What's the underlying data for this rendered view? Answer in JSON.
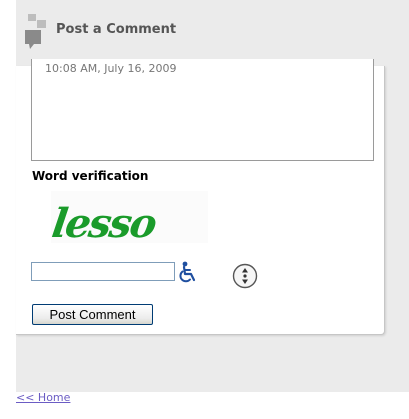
{
  "header": {
    "title": "Post a Comment",
    "icon": "comment-bubbles-icon"
  },
  "comment_box": {
    "visible_text": "10:08 AM, July 16, 2009"
  },
  "word_verification": {
    "label": "Word verification",
    "captcha_word": "lesso",
    "captcha_color": "#1a9b2a",
    "input_value": "",
    "accessibility_icon": "wheelchair-accessibility-icon",
    "audio_icon": "audio-captcha-icon"
  },
  "actions": {
    "post_label": "Post Comment"
  },
  "footer": {
    "home_link": "<< Home"
  },
  "colors": {
    "panel_bg": "#ebebeb",
    "link": "#6b5cc4",
    "accessibility_blue": "#1f4fa0"
  }
}
